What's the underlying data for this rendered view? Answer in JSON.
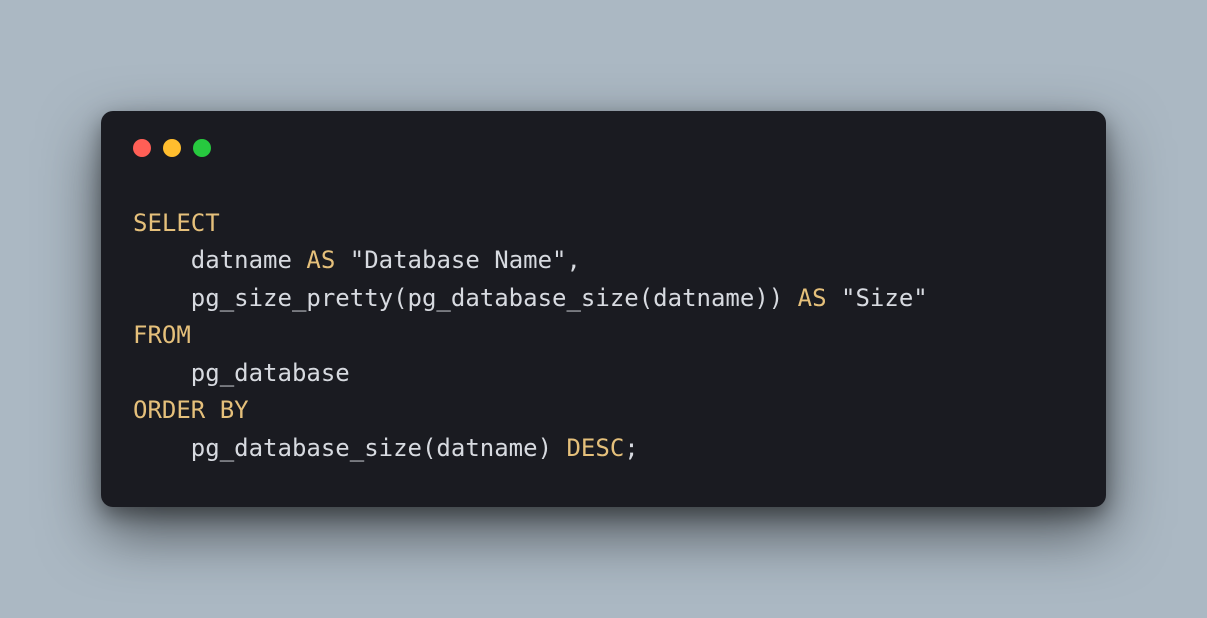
{
  "window_controls": {
    "red": "close",
    "yellow": "minimize",
    "green": "zoom"
  },
  "code": {
    "line1_kw": "SELECT",
    "line2_indent": "    ",
    "line2_id": "datname ",
    "line2_kw": "AS",
    "line2_str": " \"Database Name\"",
    "line2_end": ",",
    "line3_indent": "    ",
    "line3_fn": "pg_size_pretty(pg_database_size(datname)) ",
    "line3_kw": "AS",
    "line3_str": " \"Size\"",
    "line4_kw": "FROM",
    "line5_indent": "    ",
    "line5_id": "pg_database",
    "line6_kw": "ORDER BY",
    "line7_indent": "    ",
    "line7_fn": "pg_database_size(datname) ",
    "line7_kw": "DESC",
    "line7_end": ";"
  }
}
